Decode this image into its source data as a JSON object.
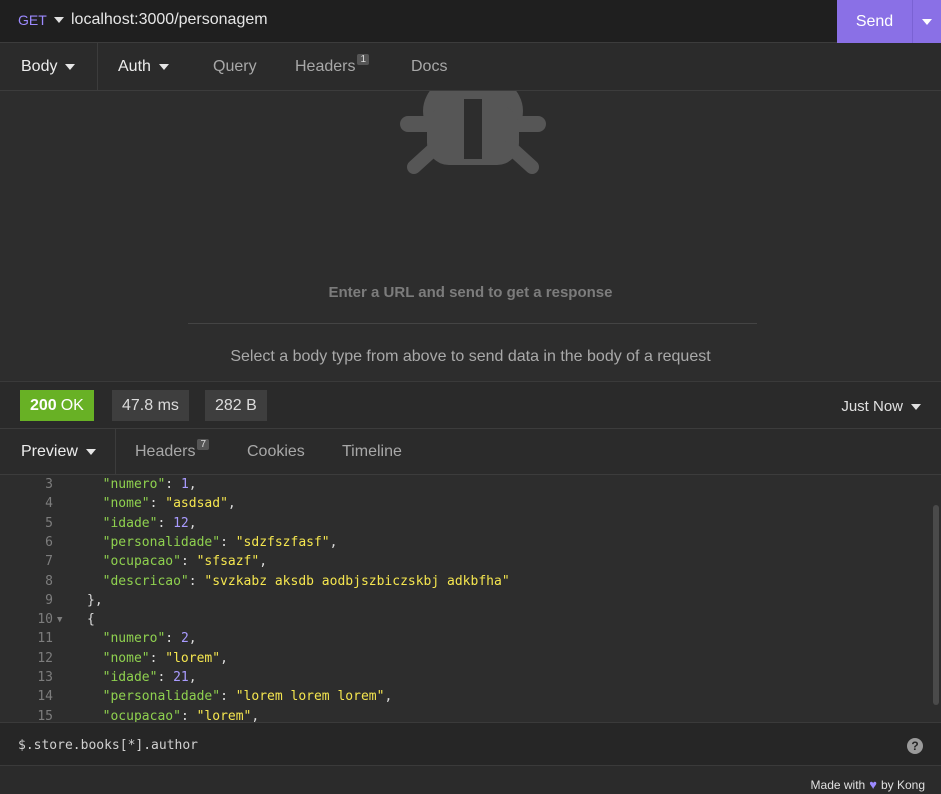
{
  "request": {
    "method": "GET",
    "url": "localhost:3000/personagem",
    "send_label": "Send"
  },
  "request_tabs": {
    "body": "Body",
    "auth": "Auth",
    "query": "Query",
    "headers": "Headers",
    "headers_count": "1",
    "docs": "Docs"
  },
  "empty_state": {
    "title": "Enter a URL and send to get a response",
    "subtitle": "Select a body type from above to send data in the body of a request"
  },
  "response": {
    "status_code": "200",
    "status_text": "OK",
    "time": "47.8 ms",
    "size": "282 B",
    "history_label": "Just Now"
  },
  "response_tabs": {
    "preview": "Preview",
    "headers": "Headers",
    "headers_count": "7",
    "cookies": "Cookies",
    "timeline": "Timeline"
  },
  "code_lines": [
    {
      "n": "3",
      "indent": "  ",
      "key": "\"numero\"",
      "val": "1",
      "type": "n",
      "tail": ","
    },
    {
      "n": "4",
      "indent": "  ",
      "key": "\"nome\"",
      "val": "\"asdsad\"",
      "type": "s",
      "tail": ","
    },
    {
      "n": "5",
      "indent": "  ",
      "key": "\"idade\"",
      "val": "12",
      "type": "n",
      "tail": ","
    },
    {
      "n": "6",
      "indent": "  ",
      "key": "\"personalidade\"",
      "val": "\"sdzfszfasf\"",
      "type": "s",
      "tail": ","
    },
    {
      "n": "7",
      "indent": "  ",
      "key": "\"ocupacao\"",
      "val": "\"sfsazf\"",
      "type": "s",
      "tail": ","
    },
    {
      "n": "8",
      "indent": "  ",
      "key": "\"descricao\"",
      "val": "\"svzkabz aksdb aodbjszbiczskbj adkbfha\"",
      "type": "s",
      "tail": ""
    },
    {
      "n": "9",
      "indent": "",
      "plain": "},"
    },
    {
      "n": "10",
      "indent": "",
      "plain": "{",
      "fold": "▼"
    },
    {
      "n": "11",
      "indent": "  ",
      "key": "\"numero\"",
      "val": "2",
      "type": "n",
      "tail": ","
    },
    {
      "n": "12",
      "indent": "  ",
      "key": "\"nome\"",
      "val": "\"lorem\"",
      "type": "s",
      "tail": ","
    },
    {
      "n": "13",
      "indent": "  ",
      "key": "\"idade\"",
      "val": "21",
      "type": "n",
      "tail": ","
    },
    {
      "n": "14",
      "indent": "  ",
      "key": "\"personalidade\"",
      "val": "\"lorem lorem lorem\"",
      "type": "s",
      "tail": ","
    },
    {
      "n": "15",
      "indent": "  ",
      "key": "\"ocupacao\"",
      "val": "\"lorem\"",
      "type": "s",
      "tail": ","
    }
  ],
  "filter": {
    "placeholder": "$.store.books[*].author",
    "help": "?"
  },
  "footer": {
    "made_with": "Made with",
    "by": "by Kong",
    "heart_icon": "heart-icon"
  },
  "colors": {
    "accent": "#8a70e6",
    "ok": "#68b125",
    "key": "#8fd14f",
    "string": "#f5e64f",
    "number": "#a99bff"
  }
}
